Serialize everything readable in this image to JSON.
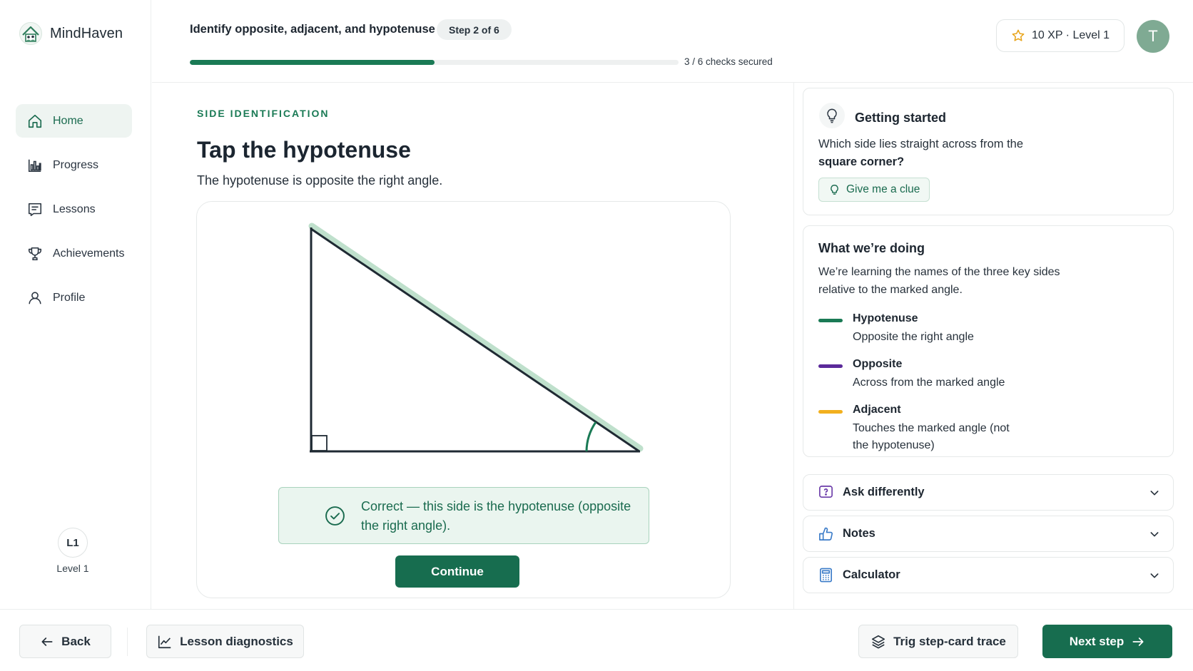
{
  "app": {
    "name": "MindHaven"
  },
  "sidebar": {
    "items": [
      {
        "label": "Home",
        "icon": "home-icon",
        "active": true
      },
      {
        "label": "Progress",
        "icon": "bar-chart-icon",
        "active": false
      },
      {
        "label": "Lessons",
        "icon": "lessons-icon",
        "active": false
      },
      {
        "label": "Achievements",
        "icon": "trophy-icon",
        "active": false
      },
      {
        "label": "Profile",
        "icon": "user-icon",
        "active": false
      }
    ],
    "level_badge": "L1",
    "level_label": "Level 1"
  },
  "header": {
    "lesson_title": "Identify opposite, adjacent, and hypotenuse",
    "step_pill": "Step 2 of 6",
    "progress": 0.5,
    "checks_label": "3 / 6 checks secured",
    "xp_label": "10 XP · Level 1",
    "avatar_initial": "T"
  },
  "main": {
    "eyebrow": "SIDE IDENTIFICATION",
    "title": "Tap the hypotenuse",
    "subtitle": "The hypotenuse is opposite the right angle.",
    "feedback": "Correct — this side is the hypotenuse (opposite the right angle).",
    "continue_label": "Continue"
  },
  "right_panel": {
    "getting_started": {
      "title": "Getting started",
      "question_prefix": "Which side lies straight across from the",
      "question_bold": "square corner?",
      "clue_label": "Give me a clue"
    },
    "what_were_doing": {
      "title": "What we’re doing",
      "body": "We’re learning the names of the three key sides relative to the marked angle.",
      "legend": [
        {
          "name": "Hypotenuse",
          "desc": "Opposite the right angle",
          "color": "#1a7a55"
        },
        {
          "name": "Opposite",
          "desc": "Across from the marked angle",
          "color": "#5b2a9a"
        },
        {
          "name": "Adjacent",
          "desc": "Touches the marked angle (not the hypotenuse)",
          "color": "#f2b01e"
        }
      ]
    },
    "accordions": [
      {
        "label": "Ask differently",
        "icon": "ask-differently-icon"
      },
      {
        "label": "Notes",
        "icon": "notes-icon"
      },
      {
        "label": "Calculator",
        "icon": "calculator-icon"
      }
    ]
  },
  "footer": {
    "back_label": "Back",
    "diagnostics_label": "Lesson diagnostics",
    "trace_label": "Trig step-card trace",
    "next_label": "Next step"
  },
  "colors": {
    "accent": "#176d4f",
    "accent_light": "#eaf5ef",
    "hypotenuse_highlight": "#bfe0cc"
  }
}
